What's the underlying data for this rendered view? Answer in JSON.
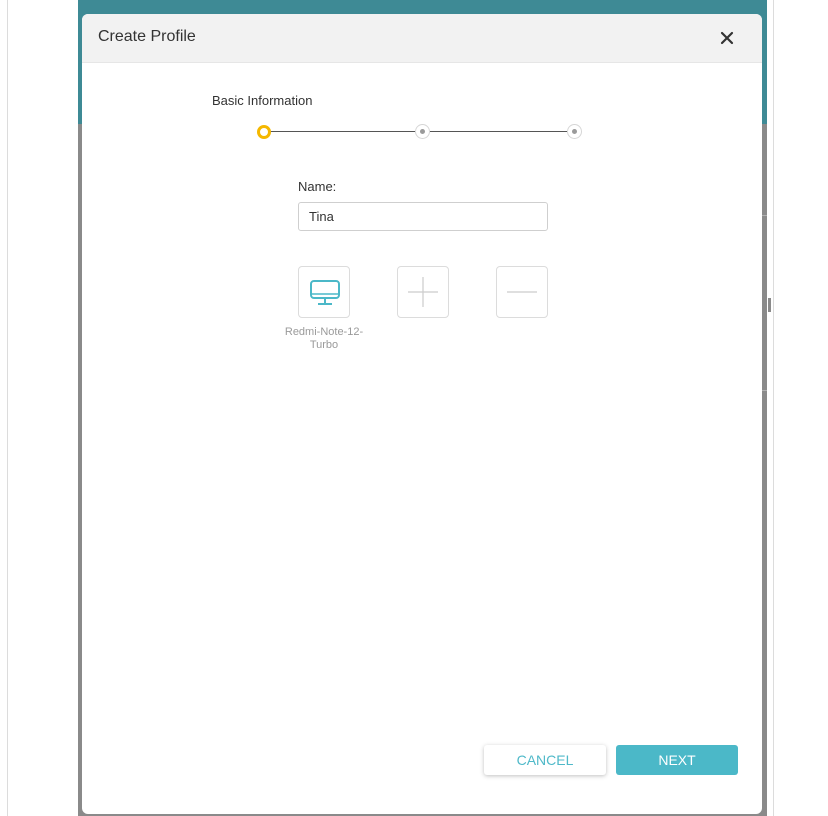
{
  "dialog": {
    "title": "Create Profile",
    "close_icon": "close-icon"
  },
  "steps": {
    "current_label": "Basic Information",
    "total": 3,
    "current_index": 1,
    "active_color": "#f5b800"
  },
  "form": {
    "name_label": "Name:",
    "name_value": "Tina"
  },
  "devices": [
    {
      "name": "Redmi-Note-12-Turbo",
      "icon": "monitor-icon"
    }
  ],
  "device_actions": {
    "add_icon": "plus-icon",
    "remove_icon": "minus-icon"
  },
  "footer": {
    "cancel_label": "CANCEL",
    "next_label": "NEXT"
  },
  "colors": {
    "accent": "#4bb8c8",
    "background_header": "#3e8a95",
    "overlay": "#8a8a8a"
  }
}
